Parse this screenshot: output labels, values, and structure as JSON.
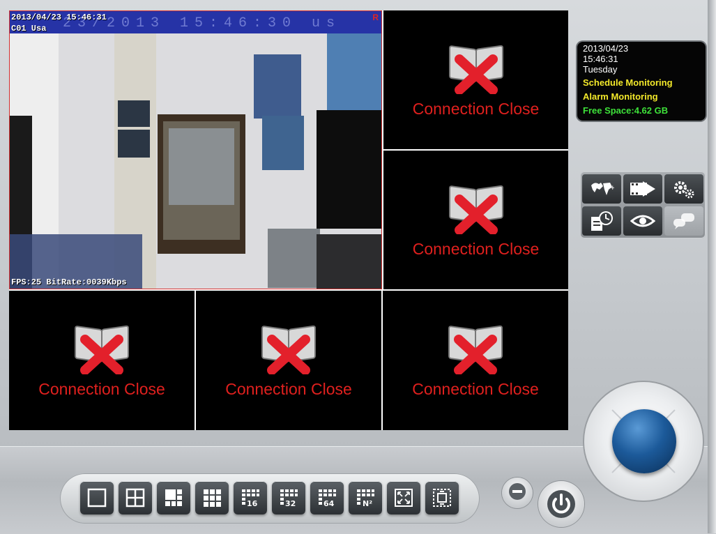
{
  "live_camera": {
    "datetime": "2013/04/23 15:46:31",
    "channel": "C01 Usa",
    "overlay_banner": "23/2013  15:46:30  us",
    "record_flag": "R",
    "stats": "FPS:25 BitRate:0039Kbps"
  },
  "channels": [
    {
      "status": "Connection Close"
    },
    {
      "status": "Connection Close"
    },
    {
      "status": "Connection Close"
    },
    {
      "status": "Connection Close"
    },
    {
      "status": "Connection Close"
    }
  ],
  "status_panel": {
    "date": "2013/04/23",
    "time": "15:46:31",
    "weekday": "Tuesday",
    "schedule": "Schedule Monitoring",
    "alarm": "Alarm Monitoring",
    "free_space": "Free Space:4.62 GB"
  },
  "tools": [
    "e-map-icon",
    "playback-icon",
    "settings-icon",
    "log-icon",
    "view-icon",
    "chat-icon"
  ],
  "layout_buttons": [
    {
      "name": "layout-1-button",
      "label": ""
    },
    {
      "name": "layout-4-button",
      "label": ""
    },
    {
      "name": "layout-6-button",
      "label": ""
    },
    {
      "name": "layout-9-button",
      "label": ""
    },
    {
      "name": "layout-16-button",
      "label": "16"
    },
    {
      "name": "layout-32-button",
      "label": "32"
    },
    {
      "name": "layout-64-button",
      "label": "64"
    },
    {
      "name": "layout-n2-button",
      "label": "N²"
    },
    {
      "name": "fullscreen-button",
      "label": ""
    },
    {
      "name": "sequence-button",
      "label": ""
    }
  ],
  "colors": {
    "error_text": "#e0201e",
    "osd_bar": "#2633a6",
    "yellow_status": "#f3e92a",
    "green_status": "#3ee23a"
  }
}
